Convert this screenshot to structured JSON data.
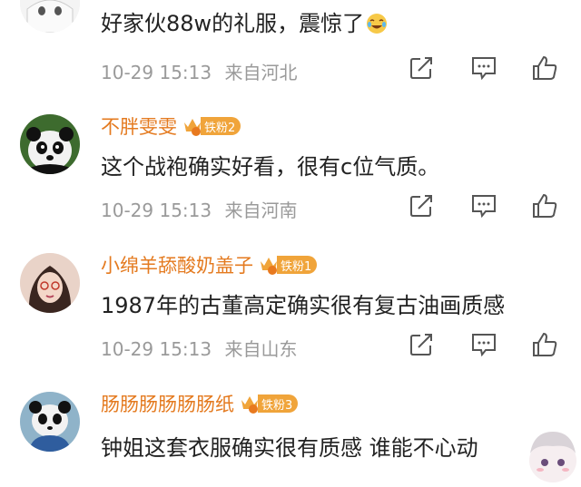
{
  "comments": [
    {
      "username": "",
      "text": "好家伙88w的礼服，震惊了",
      "emoji": "laugh-cry-emoji",
      "date": "10-29 15:13",
      "location": "来自河北"
    },
    {
      "username": "不胖雯雯",
      "crown_level": "5",
      "badge": "铁粉2",
      "text": "这个战袍确实好看，很有c位气质。",
      "date": "10-29 15:13",
      "location": "来自河南"
    },
    {
      "username": "小绵羊舔酸奶盖子",
      "crown_level": "4",
      "badge": "铁粉1",
      "text": "1987年的古董高定确实很有复古油画质感",
      "date": "10-29 15:13",
      "location": "来自山东"
    },
    {
      "username": "肠肠肠肠肠肠纸",
      "crown_level": "6",
      "badge": "铁粉3",
      "text": "钟姐这套衣服确实很有质感 谁能不心动"
    }
  ],
  "icons": [
    "share-icon",
    "reply-icon",
    "like-icon"
  ],
  "colors": {
    "username": "#e47a1f",
    "badge": "#f0a43a",
    "meta": "#9a9a9a",
    "text": "#222222"
  }
}
